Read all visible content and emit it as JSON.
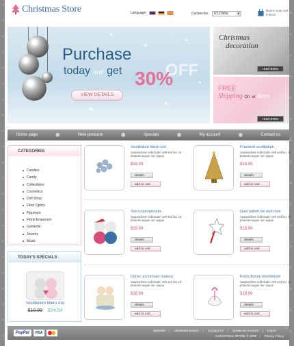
{
  "header": {
    "logo_text": "Christmas Store",
    "language_label": "Language:",
    "currencies_label": "Currencies:",
    "currency_selected": "US Dollar",
    "cart_line1": "Now in your cart",
    "cart_line2": "0 items"
  },
  "banner": {
    "purchase": "Purchase",
    "today": "today",
    "and": "and",
    "get": "get",
    "percent": "30%",
    "off": "OFF",
    "button": "VIEW DETAILS"
  },
  "promo1": {
    "title_line1": "Christmas",
    "title_line2": "decoration",
    "button": "read more"
  },
  "promo2": {
    "free": "FREE",
    "shipping": "Shipping",
    "on": "On",
    "all": "all",
    "days": "days",
    "button": "read more"
  },
  "nav": [
    "Home page",
    "New products",
    "Specials",
    "My account",
    "Contact us"
  ],
  "categories": {
    "title": "CATEGORIES",
    "items": [
      "Candles",
      "Candy",
      "Collectibles",
      "Cosmetics",
      "Doll Shop",
      "Fiber Optics",
      "Figurines",
      "Floral Emporium",
      "Garlands",
      "Jewelry",
      "Music"
    ]
  },
  "specials": {
    "title": "TODAY'S SPECIALS",
    "name": "Vestibulum libero nisl",
    "old_price": "$18.99",
    "new_price": "$14.54"
  },
  "products": [
    {
      "title": "Vestibulum libero nisl",
      "desc": "Suspendisse sollicitudin velit sed leo. Ut pharetra augue nec augue.",
      "price": "$18.99",
      "details": "details",
      "add": "add to cart"
    },
    {
      "title": "Praesent vestibulum",
      "desc": "Suspendisse sollicitudin velit sed leo. Ut pharetra augue nec augue.",
      "price": "$18.99",
      "details": "details",
      "add": "add to cart"
    },
    {
      "title": "Sed ut perspiciatis",
      "desc": "Suspendisse sollicitudin velit sed leo. Ut pharetra augue nec augue.",
      "price": "$18.99",
      "details": "details",
      "add": "add to cart"
    },
    {
      "title": "Quis autem vel eum iure",
      "desc": "Suspendisse sollicitudin velit sed leo. Ut pharetra augue nec augue.",
      "price": "$18.99",
      "details": "details",
      "add": "add to cart"
    },
    {
      "title": "Donec accumsan malesu",
      "desc": "Suspendisse sollicitudin velit sed leo. Ut pharetra augue nec augue.",
      "price": "$18.99",
      "details": "details",
      "add": "add to cart"
    },
    {
      "title": "Proin dictum elementum",
      "desc": "Suspendisse sollicitudin velit sed leo. Ut pharetra augue nec augue.",
      "price": "$18.99",
      "details": "details",
      "add": "add to cart"
    }
  ],
  "footer": {
    "paypal": "PayPal",
    "visa": "VISA",
    "links": [
      "Specials",
      "Advanced Search",
      "Contact Us",
      "Create an Account",
      "Log In"
    ],
    "copyright": "CHRISTMAS STORE © 2006",
    "privacy": "Privacy Policy"
  },
  "colors": {
    "accent_pink": "#e46f98",
    "link_blue": "#3a6ea5",
    "nav_gray": "#8a8a8a"
  }
}
